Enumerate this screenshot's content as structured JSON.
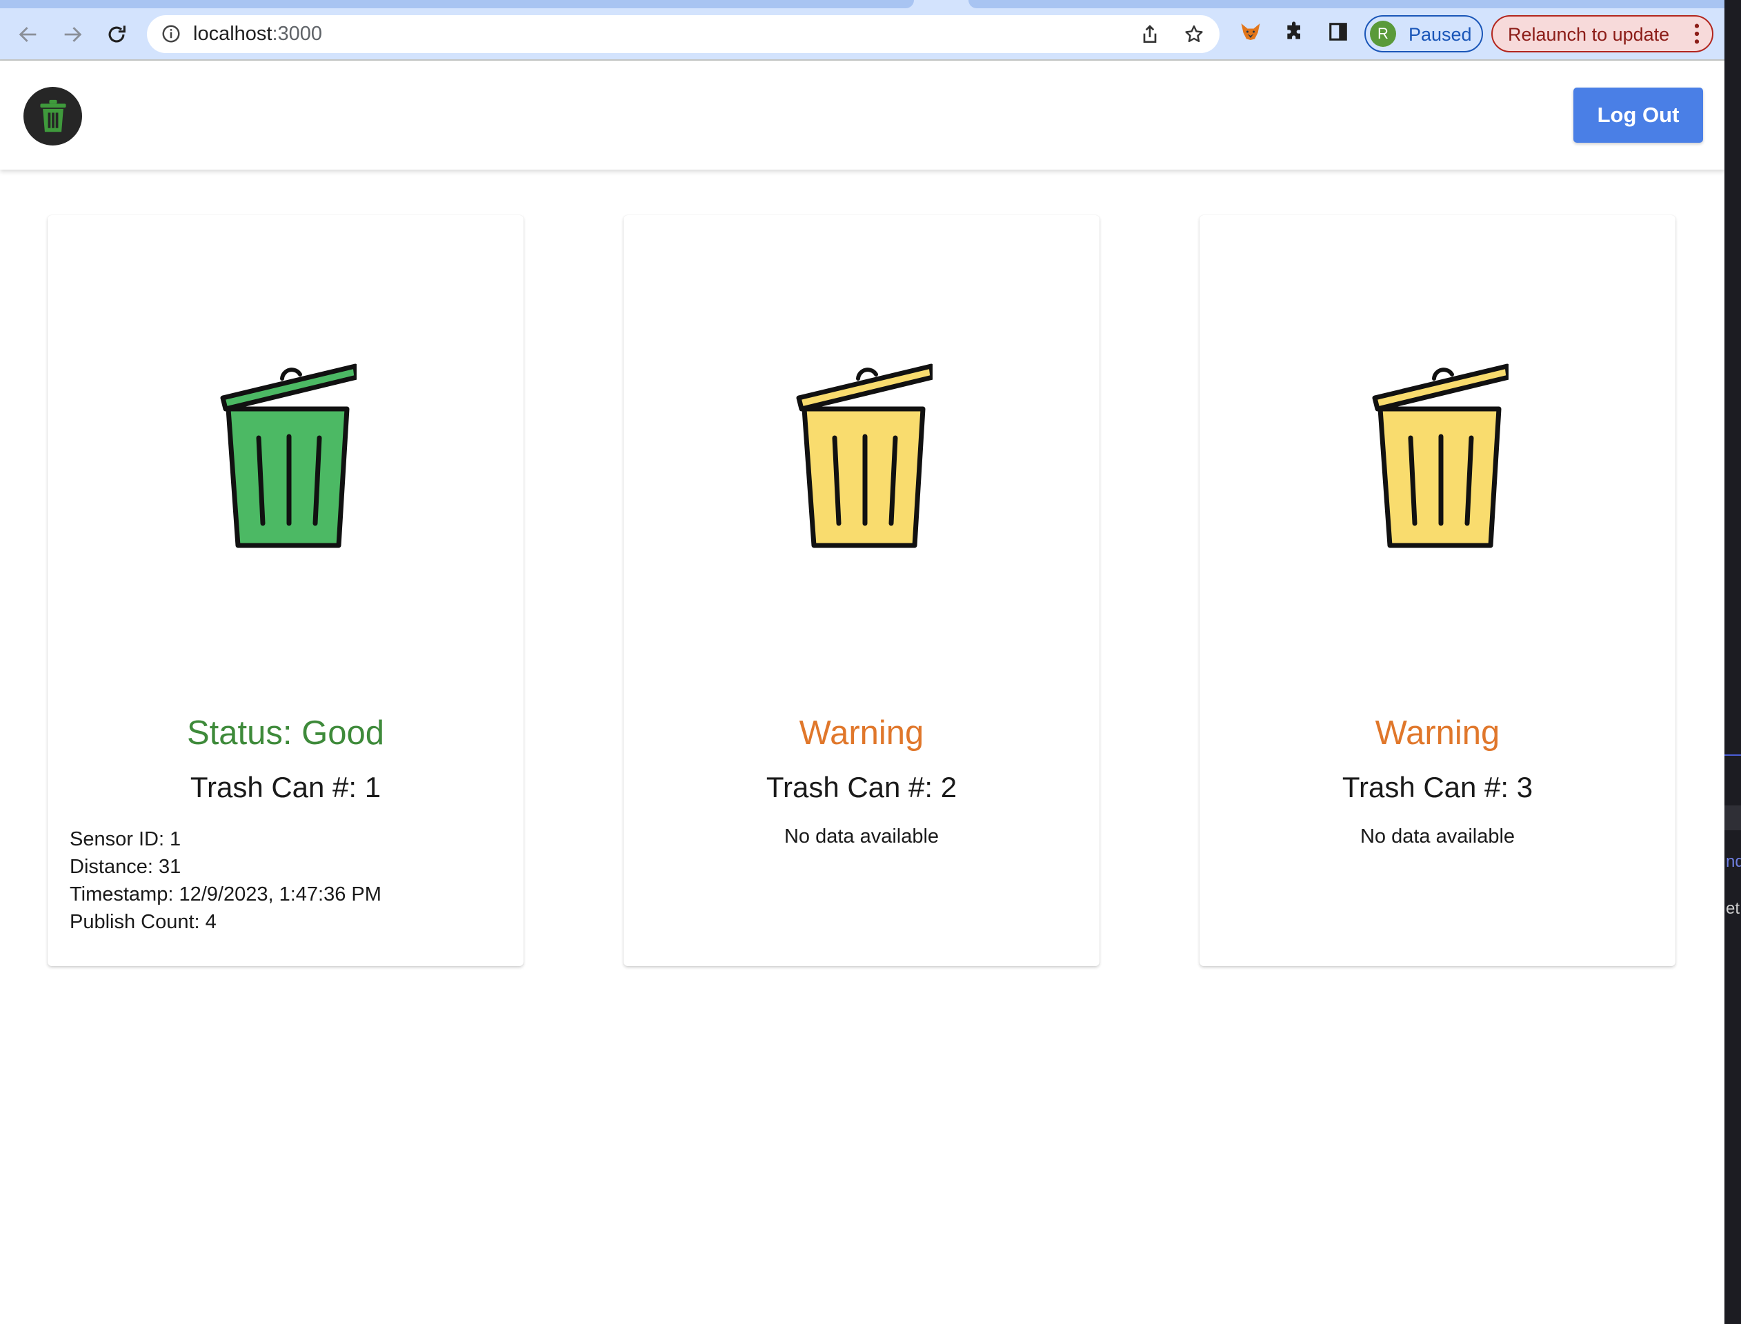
{
  "browser": {
    "url_host": "localhost",
    "url_port": ":3000",
    "profile_initial": "R",
    "profile_status": "Paused",
    "relaunch_label": "Relaunch to update"
  },
  "header": {
    "logout_label": "Log Out"
  },
  "cards": [
    {
      "status": "Status: Good",
      "title": "Trash Can #: 1",
      "icon_color": "#4cb964",
      "status_color": "#3e8a3a",
      "details": [
        "Sensor ID: 1",
        "Distance: 31",
        "Timestamp: 12/9/2023, 1:47:36 PM",
        "Publish Count: 4"
      ]
    },
    {
      "status": "Warning",
      "title": "Trash Can #: 2",
      "icon_color": "#f9dc6e",
      "status_color": "#e0772b",
      "empty_text": "No data available"
    },
    {
      "status": "Warning",
      "title": "Trash Can #: 3",
      "icon_color": "#f9dc6e",
      "status_color": "#e0772b",
      "empty_text": "No data available"
    }
  ],
  "side_window": {
    "text_a": "nd",
    "text_b": "et"
  }
}
